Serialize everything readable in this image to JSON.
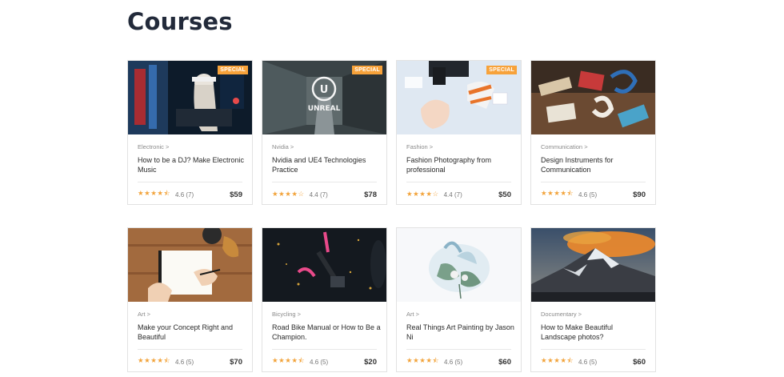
{
  "page": {
    "title": "Courses"
  },
  "colors": {
    "badge": "#f7a23a",
    "star": "#f2a33a"
  },
  "courses": [
    {
      "category": "Electronic >",
      "title": "How to be a DJ? Make Electronic Music",
      "stars": "★★★★⯪",
      "score": "4.6 (7)",
      "price": "$59",
      "badge": "SPECIAL"
    },
    {
      "category": "Nvidia >",
      "title": "Nvidia and UE4 Technologies Practice",
      "stars": "★★★★☆",
      "score": "4.4 (7)",
      "price": "$78",
      "badge": "SPECIAL",
      "logo_text": "UNREAL"
    },
    {
      "category": "Fashion >",
      "title": "Fashion Photography from professional",
      "stars": "★★★★☆",
      "score": "4.4 (7)",
      "price": "$50",
      "badge": "SPECIAL"
    },
    {
      "category": "Communication >",
      "title": "Design Instruments for Communication",
      "stars": "★★★★⯪",
      "score": "4.6 (5)",
      "price": "$90"
    },
    {
      "category": "Art >",
      "title": "Make your Concept Right and Beautiful",
      "stars": "★★★★⯪",
      "score": "4.6 (5)",
      "price": "$70"
    },
    {
      "category": "Bicycling >",
      "title": "Road Bike Manual or How to Be a Champion.",
      "stars": "★★★★⯪",
      "score": "4.6 (5)",
      "price": "$20"
    },
    {
      "category": "Art >",
      "title": "Real Things Art Painting by Jason Ni",
      "stars": "★★★★⯪",
      "score": "4.6 (5)",
      "price": "$60"
    },
    {
      "category": "Documentary >",
      "title": "How to Make Beautiful Landscape photos?",
      "stars": "★★★★⯪",
      "score": "4.6 (5)",
      "price": "$60"
    }
  ]
}
